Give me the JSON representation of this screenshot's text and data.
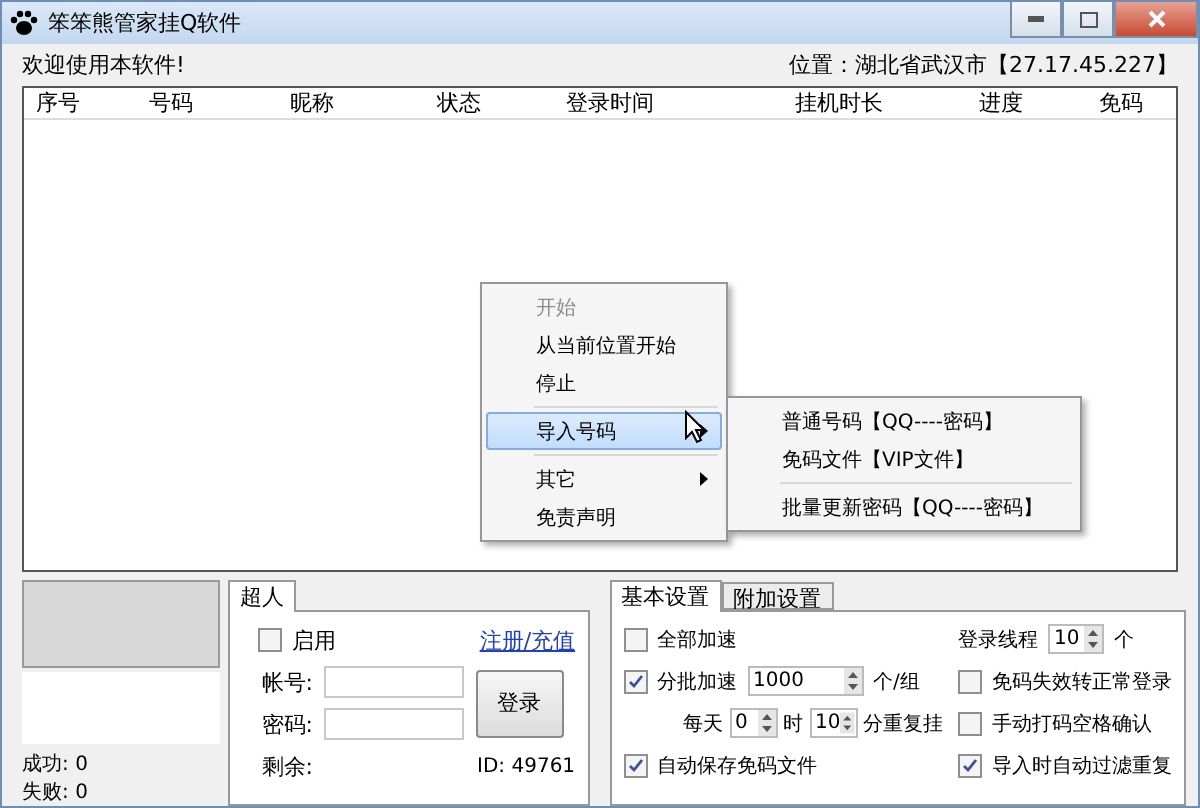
{
  "window": {
    "title": "笨笨熊管家挂Q软件"
  },
  "welcome": "欢迎使用本软件!",
  "location": "位置：湖北省武汉市【27.17.45.227】",
  "table": {
    "columns": [
      "序号",
      "号码",
      "昵称",
      "状态",
      "登录时间",
      "挂机时长",
      "进度",
      "免码"
    ]
  },
  "context_menu": {
    "items": [
      {
        "kind": "item",
        "label": "开始",
        "disabled": true,
        "selected": false,
        "submenu": false
      },
      {
        "kind": "item",
        "label": "从当前位置开始",
        "disabled": false,
        "selected": false,
        "submenu": false
      },
      {
        "kind": "item",
        "label": "停止",
        "disabled": false,
        "selected": false,
        "submenu": false
      },
      {
        "kind": "separator"
      },
      {
        "kind": "item",
        "label": "导入号码",
        "disabled": false,
        "selected": true,
        "submenu": true
      },
      {
        "kind": "separator"
      },
      {
        "kind": "item",
        "label": "其它",
        "disabled": false,
        "selected": false,
        "submenu": true
      },
      {
        "kind": "item",
        "label": "免责声明",
        "disabled": false,
        "selected": false,
        "submenu": false
      }
    ]
  },
  "submenu": {
    "items": [
      {
        "kind": "item",
        "label": "普通号码【QQ----密码】"
      },
      {
        "kind": "item",
        "label": "免码文件【VIP文件】"
      },
      {
        "kind": "separator"
      },
      {
        "kind": "item",
        "label": "批量更新密码【QQ----密码】"
      }
    ]
  },
  "stats": [
    {
      "label": "成功:",
      "value": "0"
    },
    {
      "label": "失败:",
      "value": "0"
    }
  ],
  "account": {
    "tabs": [
      {
        "label": "超人",
        "selected": true
      }
    ],
    "enable": {
      "label": "启用",
      "checked": false
    },
    "register_link": "注册/充值",
    "account_label": "帐号:",
    "password_label": "密码:",
    "login_button": "登录",
    "remaining_label": "剩余:",
    "id_text": "ID: 49761"
  },
  "settings": {
    "tabs": [
      {
        "label": "基本设置",
        "selected": true
      },
      {
        "label": "附加设置",
        "selected": false
      }
    ],
    "all_speedup": {
      "label": "全部加速",
      "checked": false
    },
    "threads": {
      "label": "登录线程",
      "value": "10",
      "unit": "个"
    },
    "batch_speedup": {
      "label": "分批加速",
      "checked": true,
      "value": "1000",
      "unit": "个/组"
    },
    "fallback_login": {
      "label": "免码失效转正常登录",
      "checked": false
    },
    "daily": {
      "label": "每天",
      "hours": "0",
      "hours_unit": "时",
      "minutes": "10",
      "minutes_unit": "分重复挂"
    },
    "manual_captcha": {
      "label": "手动打码空格确认",
      "checked": false
    },
    "auto_save": {
      "label": "自动保存免码文件",
      "checked": true
    },
    "filter_duplicates": {
      "label": "导入时自动过滤重复",
      "checked": true
    }
  }
}
